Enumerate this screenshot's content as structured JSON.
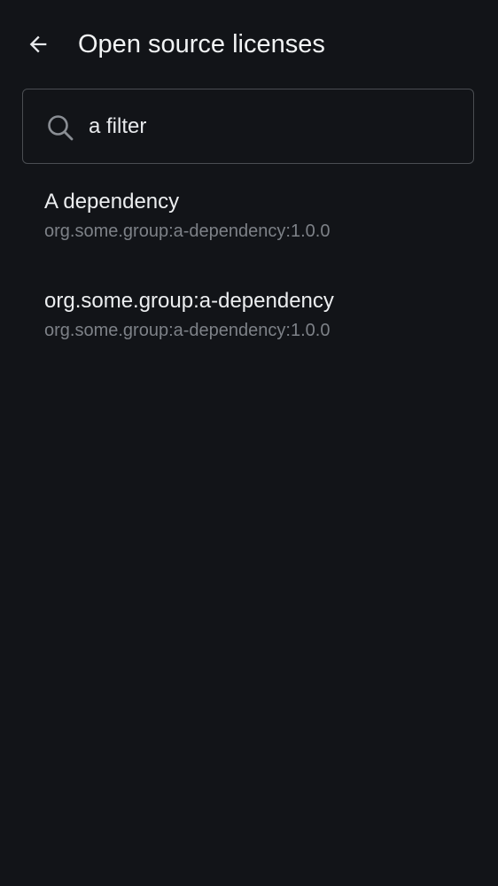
{
  "header": {
    "back_icon": "arrow-back-icon",
    "title": "Open source licenses"
  },
  "search": {
    "icon": "search-icon",
    "value": "a filter"
  },
  "licenses": [
    {
      "name": "A dependency",
      "coordinates": "org.some.group:a-dependency:1.0.0"
    },
    {
      "name": "org.some.group:a-dependency",
      "coordinates": "org.some.group:a-dependency:1.0.0"
    }
  ],
  "colors": {
    "background": "#121418",
    "primary_text": "#e8eaed",
    "secondary_text": "#7d8187",
    "outline": "#4a4d52"
  }
}
